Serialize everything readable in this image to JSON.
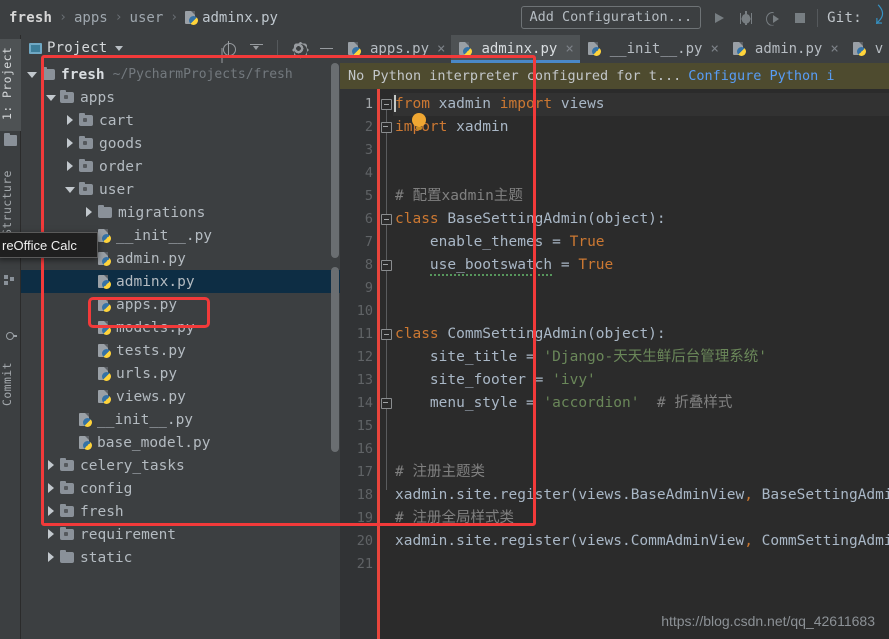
{
  "breadcrumb": {
    "root": "fresh",
    "items": [
      "apps",
      "user"
    ],
    "file": "adminx.py",
    "separator": "›"
  },
  "toolbar": {
    "add_configuration": "Add Configuration...",
    "git_label": "Git:",
    "run_icon": "run-icon",
    "debug_icon": "debug-icon",
    "coverage_icon": "coverage-icon",
    "stop_icon": "stop-icon",
    "git_update_icon": "git-update-arrow-icon"
  },
  "left_strip": {
    "project_tab": "1: Project",
    "structure_tab": "7: Structure",
    "commit_tab": "Commit"
  },
  "project_panel": {
    "title": "Project",
    "locate_icon": "locate-icon",
    "collapse_icon": "collapse-all-icon",
    "settings_icon": "gear-icon",
    "hide_icon": "minimize-icon"
  },
  "tooltip": {
    "text": "reOffice Calc"
  },
  "tree": [
    {
      "label": "fresh",
      "sub": "~/PycharmProjects/fresh",
      "indent": 0,
      "arrow": "open",
      "icon": "folder",
      "type": "root"
    },
    {
      "label": "apps",
      "sub": "",
      "indent": 1,
      "arrow": "open",
      "icon": "module-folder",
      "type": "dir"
    },
    {
      "label": "cart",
      "sub": "",
      "indent": 2,
      "arrow": "closed",
      "icon": "module-folder",
      "type": "dir"
    },
    {
      "label": "goods",
      "sub": "",
      "indent": 2,
      "arrow": "closed",
      "icon": "module-folder",
      "type": "dir"
    },
    {
      "label": "order",
      "sub": "",
      "indent": 2,
      "arrow": "closed",
      "icon": "module-folder",
      "type": "dir"
    },
    {
      "label": "user",
      "sub": "",
      "indent": 2,
      "arrow": "open",
      "icon": "module-folder",
      "type": "dir"
    },
    {
      "label": "migrations",
      "sub": "",
      "indent": 3,
      "arrow": "closed",
      "icon": "folder",
      "type": "dir"
    },
    {
      "label": "__init__.py",
      "sub": "",
      "indent": 3,
      "arrow": "none",
      "icon": "python-file",
      "type": "file"
    },
    {
      "label": "admin.py",
      "sub": "",
      "indent": 3,
      "arrow": "none",
      "icon": "python-file",
      "type": "file"
    },
    {
      "label": "adminx.py",
      "sub": "",
      "indent": 3,
      "arrow": "none",
      "icon": "python-file",
      "type": "file",
      "selected": true
    },
    {
      "label": "apps.py",
      "sub": "",
      "indent": 3,
      "arrow": "none",
      "icon": "python-file",
      "type": "file"
    },
    {
      "label": "models.py",
      "sub": "",
      "indent": 3,
      "arrow": "none",
      "icon": "python-file",
      "type": "file"
    },
    {
      "label": "tests.py",
      "sub": "",
      "indent": 3,
      "arrow": "none",
      "icon": "python-file",
      "type": "file"
    },
    {
      "label": "urls.py",
      "sub": "",
      "indent": 3,
      "arrow": "none",
      "icon": "python-file",
      "type": "file"
    },
    {
      "label": "views.py",
      "sub": "",
      "indent": 3,
      "arrow": "none",
      "icon": "python-file",
      "type": "file"
    },
    {
      "label": "__init__.py",
      "sub": "",
      "indent": 2,
      "arrow": "none",
      "icon": "python-file",
      "type": "file"
    },
    {
      "label": "base_model.py",
      "sub": "",
      "indent": 2,
      "arrow": "none",
      "icon": "python-file",
      "type": "file"
    },
    {
      "label": "celery_tasks",
      "sub": "",
      "indent": 1,
      "arrow": "closed",
      "icon": "module-folder",
      "type": "dir"
    },
    {
      "label": "config",
      "sub": "",
      "indent": 1,
      "arrow": "closed",
      "icon": "module-folder",
      "type": "dir"
    },
    {
      "label": "fresh",
      "sub": "",
      "indent": 1,
      "arrow": "closed",
      "icon": "module-folder",
      "type": "dir"
    },
    {
      "label": "requirement",
      "sub": "",
      "indent": 1,
      "arrow": "closed",
      "icon": "module-folder",
      "type": "dir"
    },
    {
      "label": "static",
      "sub": "",
      "indent": 1,
      "arrow": "closed",
      "icon": "folder",
      "type": "dir"
    }
  ],
  "editor_tabs": [
    {
      "label": "apps.py",
      "active": false,
      "close": "×"
    },
    {
      "label": "adminx.py",
      "active": true,
      "close": "×"
    },
    {
      "label": "__init__.py",
      "active": false,
      "close": "×"
    },
    {
      "label": "admin.py",
      "active": false,
      "close": "×"
    },
    {
      "label": "v",
      "active": false,
      "close": ""
    }
  ],
  "warning_bar": {
    "message": "No Python interpreter configured for t...",
    "link": "Configure Python i"
  },
  "code": {
    "line_numbers": [
      "1",
      "2",
      "3",
      "4",
      "5",
      "6",
      "7",
      "8",
      "9",
      "10",
      "11",
      "12",
      "13",
      "14",
      "15",
      "16",
      "17",
      "18",
      "19",
      "20",
      "21"
    ],
    "current_line": 1,
    "lines": [
      "from xadmin import views",
      "import xadmin",
      "",
      "",
      "# 配置xadmin主题",
      "class BaseSettingAdmin(object):",
      "    enable_themes = True",
      "    use_bootswatch = True",
      "",
      "",
      "class CommSettingAdmin(object):",
      "    site_title = 'Django-天天生鲜后台管理系统'",
      "    site_footer = 'ivy'",
      "    menu_style = 'accordion'  # 折叠样式",
      "",
      "",
      "# 注册主题类",
      "xadmin.site.register(views.BaseAdminView, BaseSettingAdmin)",
      "# 注册全局样式类",
      "xadmin.site.register(views.CommAdminView, CommSettingAdmin)",
      ""
    ]
  },
  "watermark": "https://blog.csdn.net/qq_42611683",
  "colors": {
    "accent_blue": "#4a88c7",
    "selection_navy": "#0d2d44",
    "annotation_red": "#f23a3a",
    "warning_olive": "#4e4b2f",
    "keyword_orange": "#cc7832",
    "string_green": "#6a8759",
    "comment_gray": "#808080",
    "default_text": "#a9b7c6",
    "editor_bg": "#2b2b2b",
    "panel_bg": "#3c3f41",
    "link_blue": "#589df6",
    "error_stripe_red": "#e8453c"
  }
}
